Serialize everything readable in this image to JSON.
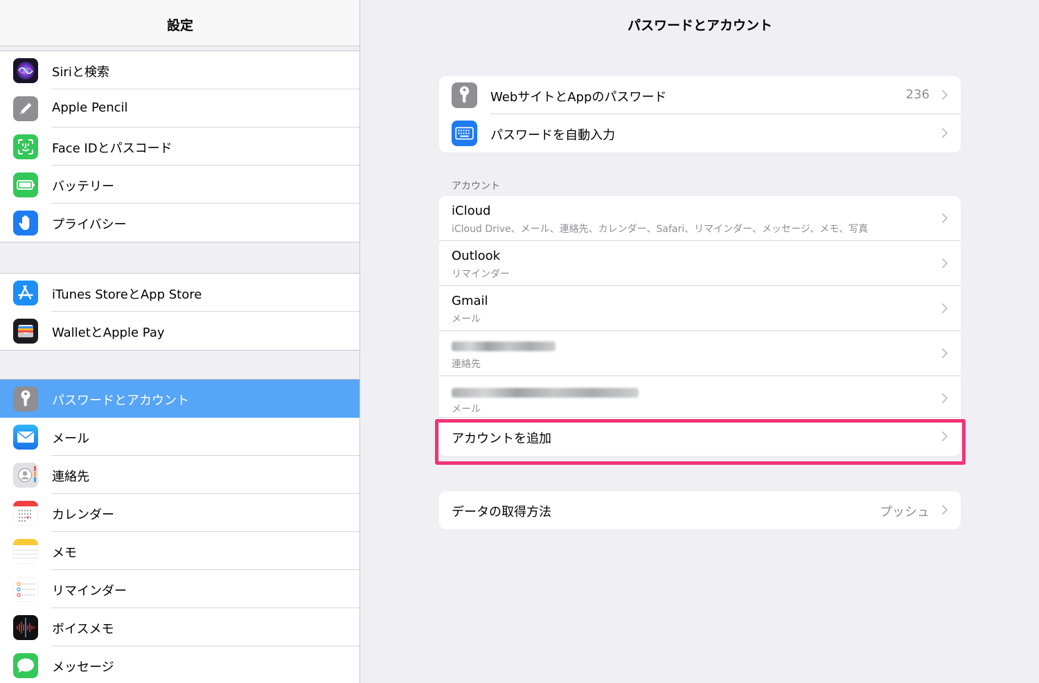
{
  "sidebar": {
    "title": "設定",
    "groups": [
      [
        {
          "label": "Siriと検索",
          "icon": "siri-icon"
        },
        {
          "label": "Apple Pencil",
          "icon": "pencil-icon"
        },
        {
          "label": "Face IDとパスコード",
          "icon": "face-id-icon"
        },
        {
          "label": "バッテリー",
          "icon": "battery-icon"
        },
        {
          "label": "プライバシー",
          "icon": "hand-icon"
        }
      ],
      [
        {
          "label": "iTunes StoreとApp Store",
          "icon": "app-store-icon"
        },
        {
          "label": "WalletとApple Pay",
          "icon": "wallet-icon"
        }
      ],
      [
        {
          "label": "パスワードとアカウント",
          "icon": "key-icon",
          "selected": true
        },
        {
          "label": "メール",
          "icon": "mail-icon"
        },
        {
          "label": "連絡先",
          "icon": "contacts-icon"
        },
        {
          "label": "カレンダー",
          "icon": "calendar-icon"
        },
        {
          "label": "メモ",
          "icon": "notes-icon"
        },
        {
          "label": "リマインダー",
          "icon": "reminders-icon"
        },
        {
          "label": "ボイスメモ",
          "icon": "voice-memo-icon"
        },
        {
          "label": "メッセージ",
          "icon": "messages-icon"
        }
      ]
    ]
  },
  "main": {
    "title": "パスワードとアカウント",
    "passwords": [
      {
        "label": "WebサイトとAppのパスワード",
        "value": "236",
        "icon": "key-icon"
      },
      {
        "label": "パスワードを自動入力",
        "value": "",
        "icon": "keyboard-icon"
      }
    ],
    "accounts_header": "アカウント",
    "accounts": [
      {
        "name": "iCloud",
        "detail": "iCloud Drive、メール、連絡先、カレンダー、Safari、リマインダー、メッセージ、メモ、写真"
      },
      {
        "name": "Outlook",
        "detail": "リマインダー"
      },
      {
        "name": "Gmail",
        "detail": "メール"
      },
      {
        "name": "",
        "detail": "連絡先",
        "redacted": true
      },
      {
        "name": "",
        "detail": "メール",
        "redacted": true
      }
    ],
    "add_account": "アカウントを追加",
    "fetch": {
      "label": "データの取得方法",
      "value": "プッシュ"
    }
  },
  "colors": {
    "selected_row": "#56a5f7",
    "highlight_box": "#f23375",
    "background": "#efeff4"
  }
}
